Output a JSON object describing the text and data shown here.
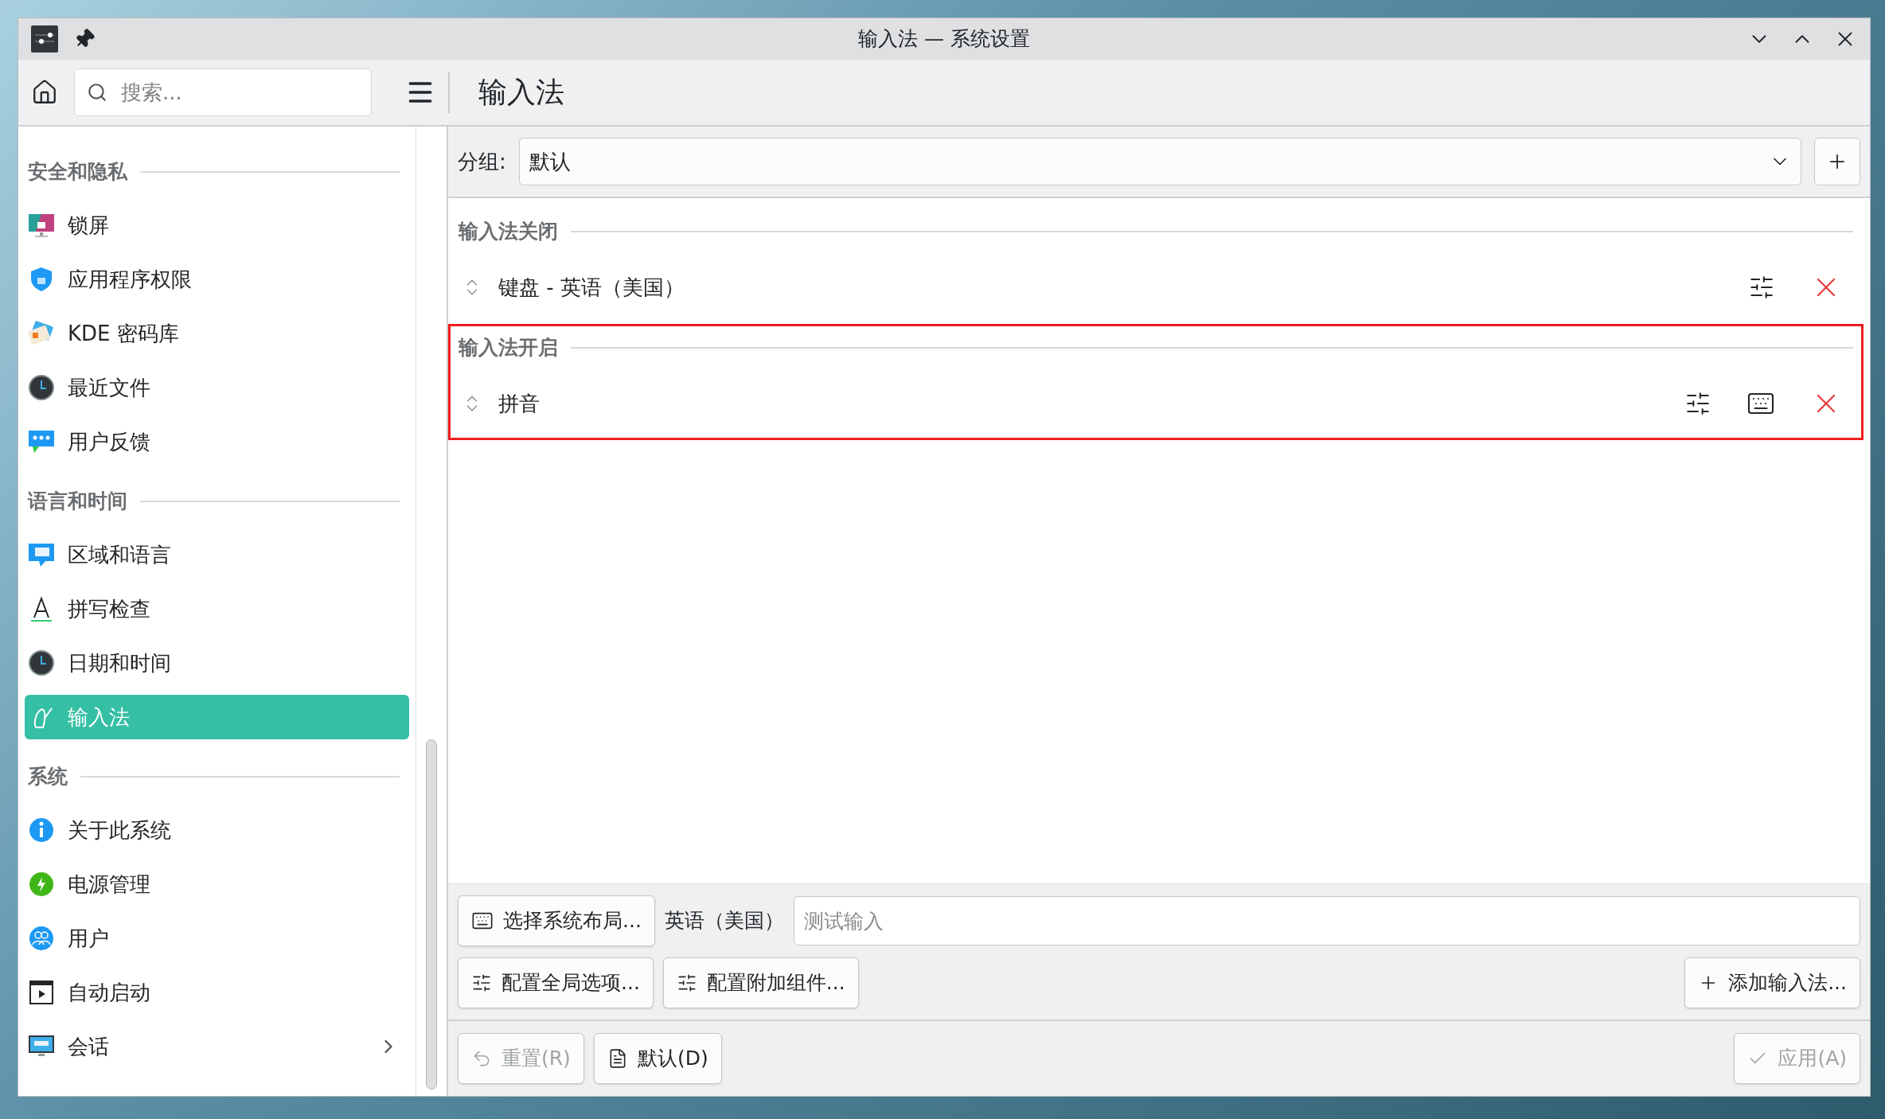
{
  "window": {
    "title": "输入法 — 系统设置"
  },
  "toolbar": {
    "search_placeholder": "搜索...",
    "page_title": "输入法"
  },
  "sidebar": {
    "sections": [
      {
        "title": "安全和隐私",
        "items": [
          {
            "label": "锁屏",
            "selected": false,
            "expandable": false
          },
          {
            "label": "应用程序权限",
            "selected": false,
            "expandable": false
          },
          {
            "label": "KDE 密码库",
            "selected": false,
            "expandable": false
          },
          {
            "label": "最近文件",
            "selected": false,
            "expandable": false
          },
          {
            "label": "用户反馈",
            "selected": false,
            "expandable": false
          }
        ]
      },
      {
        "title": "语言和时间",
        "items": [
          {
            "label": "区域和语言",
            "selected": false,
            "expandable": false
          },
          {
            "label": "拼写检查",
            "selected": false,
            "expandable": false
          },
          {
            "label": "日期和时间",
            "selected": false,
            "expandable": false
          },
          {
            "label": "输入法",
            "selected": true,
            "expandable": false
          }
        ]
      },
      {
        "title": "系统",
        "items": [
          {
            "label": "关于此系统",
            "selected": false,
            "expandable": false
          },
          {
            "label": "电源管理",
            "selected": false,
            "expandable": false
          },
          {
            "label": "用户",
            "selected": false,
            "expandable": false
          },
          {
            "label": "自动启动",
            "selected": false,
            "expandable": false
          },
          {
            "label": "会话",
            "selected": false,
            "expandable": true
          }
        ]
      }
    ]
  },
  "group": {
    "label": "分组:",
    "value": "默认"
  },
  "sections": [
    {
      "title": "输入法关闭",
      "highlighted": false,
      "items": [
        {
          "label": "键盘 - 英语（美国）",
          "layout_button": false
        }
      ]
    },
    {
      "title": "输入法开启",
      "highlighted": true,
      "items": [
        {
          "label": "拼音",
          "layout_button": true
        }
      ]
    }
  ],
  "bottom": {
    "layout_button": "选择系统布局...",
    "layout_name": "英语（美国）",
    "test_placeholder": "测试输入",
    "global_button": "配置全局选项...",
    "addons_button": "配置附加组件...",
    "add_button": "添加输入法..."
  },
  "footer": {
    "reset": {
      "label": "重置(R)",
      "disabled": true
    },
    "defaults": {
      "label": "默认(D)",
      "disabled": false
    },
    "apply": {
      "label": "应用(A)",
      "disabled": true
    }
  }
}
